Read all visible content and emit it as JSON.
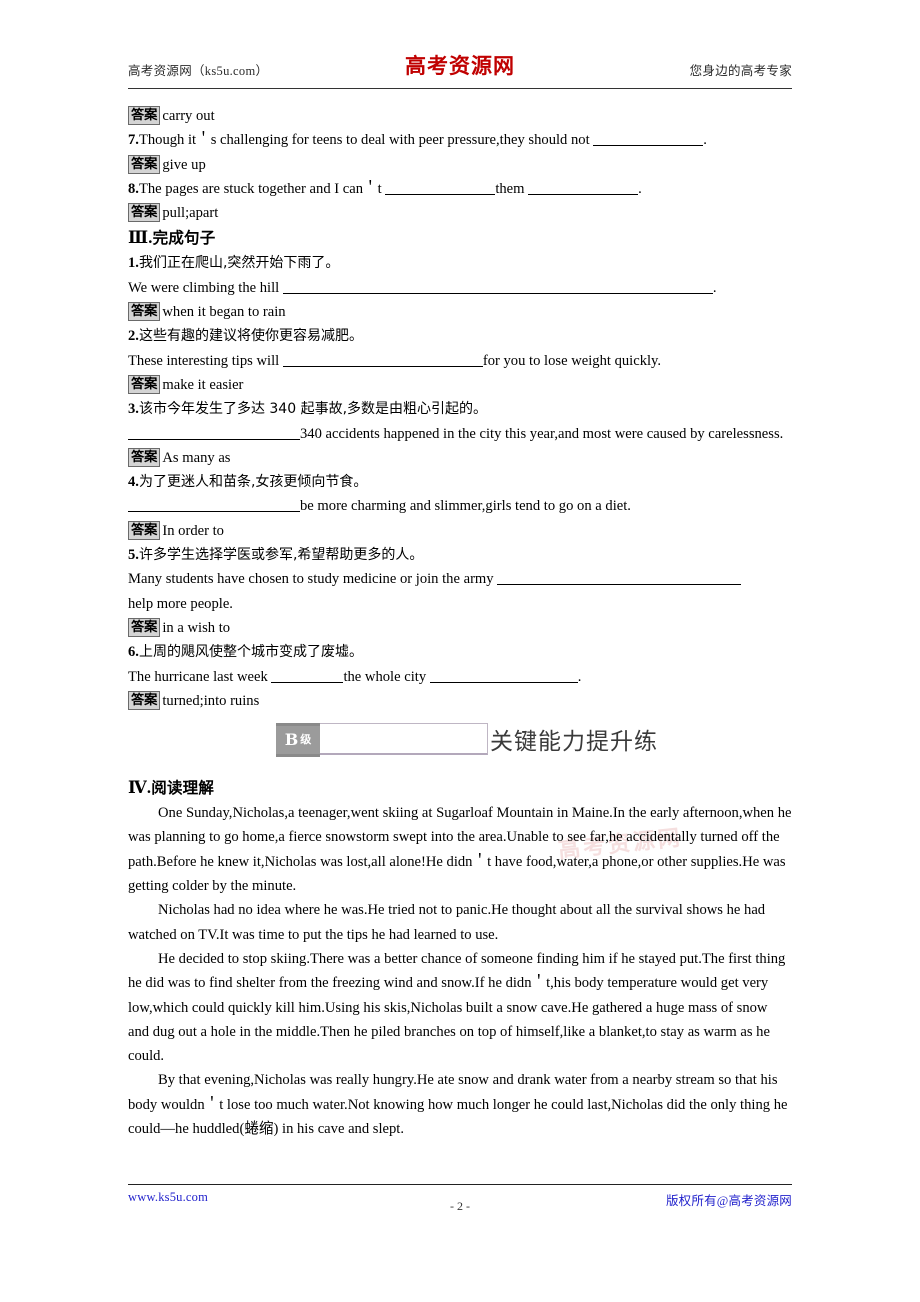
{
  "header": {
    "left": "高考资源网（ks5u.com）",
    "logo": "高考资源网",
    "right": "您身边的高考专家"
  },
  "footer": {
    "left": "www.ks5u.com",
    "page_number": "- 2 -",
    "right": "版权所有@高考资源网"
  },
  "watermark": "高考资源网",
  "answer_label": "答案",
  "carryover": {
    "answer6": "carry out",
    "q7_num": "7.",
    "q7_text_a": "Though it＇s challenging for teens to deal with peer pressure,they should not ",
    "q7_text_b": ".",
    "answer7": "give up",
    "q8_num": "8.",
    "q8_text_a": "The pages are stuck together and I can＇t ",
    "q8_text_b": "them ",
    "q8_text_c": ".",
    "answer8": "pull;apart"
  },
  "section3": {
    "heading_roman": "Ⅲ.",
    "heading_cn": "完成句子",
    "items": [
      {
        "num": "1.",
        "chinese": "我们正在爬山,突然开始下雨了。",
        "english_a": "We were climbing the hill ",
        "english_b": ".",
        "answer": "when it began to rain"
      },
      {
        "num": "2.",
        "chinese": "这些有趣的建议将使你更容易减肥。",
        "english_a": "These interesting tips will ",
        "english_b": "for you to lose weight quickly.",
        "answer": "make it easier"
      },
      {
        "num": "3.",
        "chinese": "该市今年发生了多达 340 起事故,多数是由粗心引起的。",
        "english_a": "",
        "english_b": "340 accidents happened in the city this year,and most were caused by carelessness.",
        "answer": "As many as"
      },
      {
        "num": "4.",
        "chinese": "为了更迷人和苗条,女孩更倾向节食。",
        "english_a": "",
        "english_b": "be more charming and slimmer,girls tend to go on a diet.",
        "answer": "In order to"
      },
      {
        "num": "5.",
        "chinese": "许多学生选择学医或参军,希望帮助更多的人。",
        "english_a": "Many students have chosen to study medicine or join the army ",
        "english_b": "help more people.",
        "answer": "in a wish to"
      },
      {
        "num": "6.",
        "chinese": "上周的飓风使整个城市变成了废墟。",
        "english_a": "The hurricane last week ",
        "english_b": "the whole city ",
        "english_c": ".",
        "answer": "turned;into ruins"
      }
    ]
  },
  "level_banner": {
    "badge_letter": "B",
    "badge_cn": "级",
    "title": "关键能力提升练"
  },
  "section4": {
    "heading_roman": "Ⅳ.",
    "heading_cn": "阅读理解",
    "paragraphs": [
      "One Sunday,Nicholas,a teenager,went skiing at Sugarloaf Mountain in Maine.In the early afternoon,when he was planning to go home,a fierce snowstorm swept into the area.Unable to see far,he accidentally turned off the path.Before he knew it,Nicholas was lost,all alone!He didn＇t have food,water,a phone,or other supplies.He was getting colder by the minute.",
      "Nicholas had no idea where he was.He tried not to panic.He thought about all the survival shows he had watched on TV.It was time to put the tips he had learned to use.",
      "He decided to stop skiing.There was a better chance of someone finding him if he stayed put.The first thing he did was to find shelter from the freezing wind and snow.If he didn＇t,his body temperature would get very low,which could quickly kill him.Using his skis,Nicholas built a snow cave.He gathered a huge mass of snow and dug out a hole in the middle.Then he piled branches on top of himself,like a blanket,to stay as warm as he could.",
      "By that evening,Nicholas was really hungry.He ate snow and drank water from a nearby stream so that his body wouldn＇t lose too much water.Not knowing how much longer he could last,Nicholas did the only thing he could—he huddled(蜷缩) in his cave and slept."
    ]
  }
}
